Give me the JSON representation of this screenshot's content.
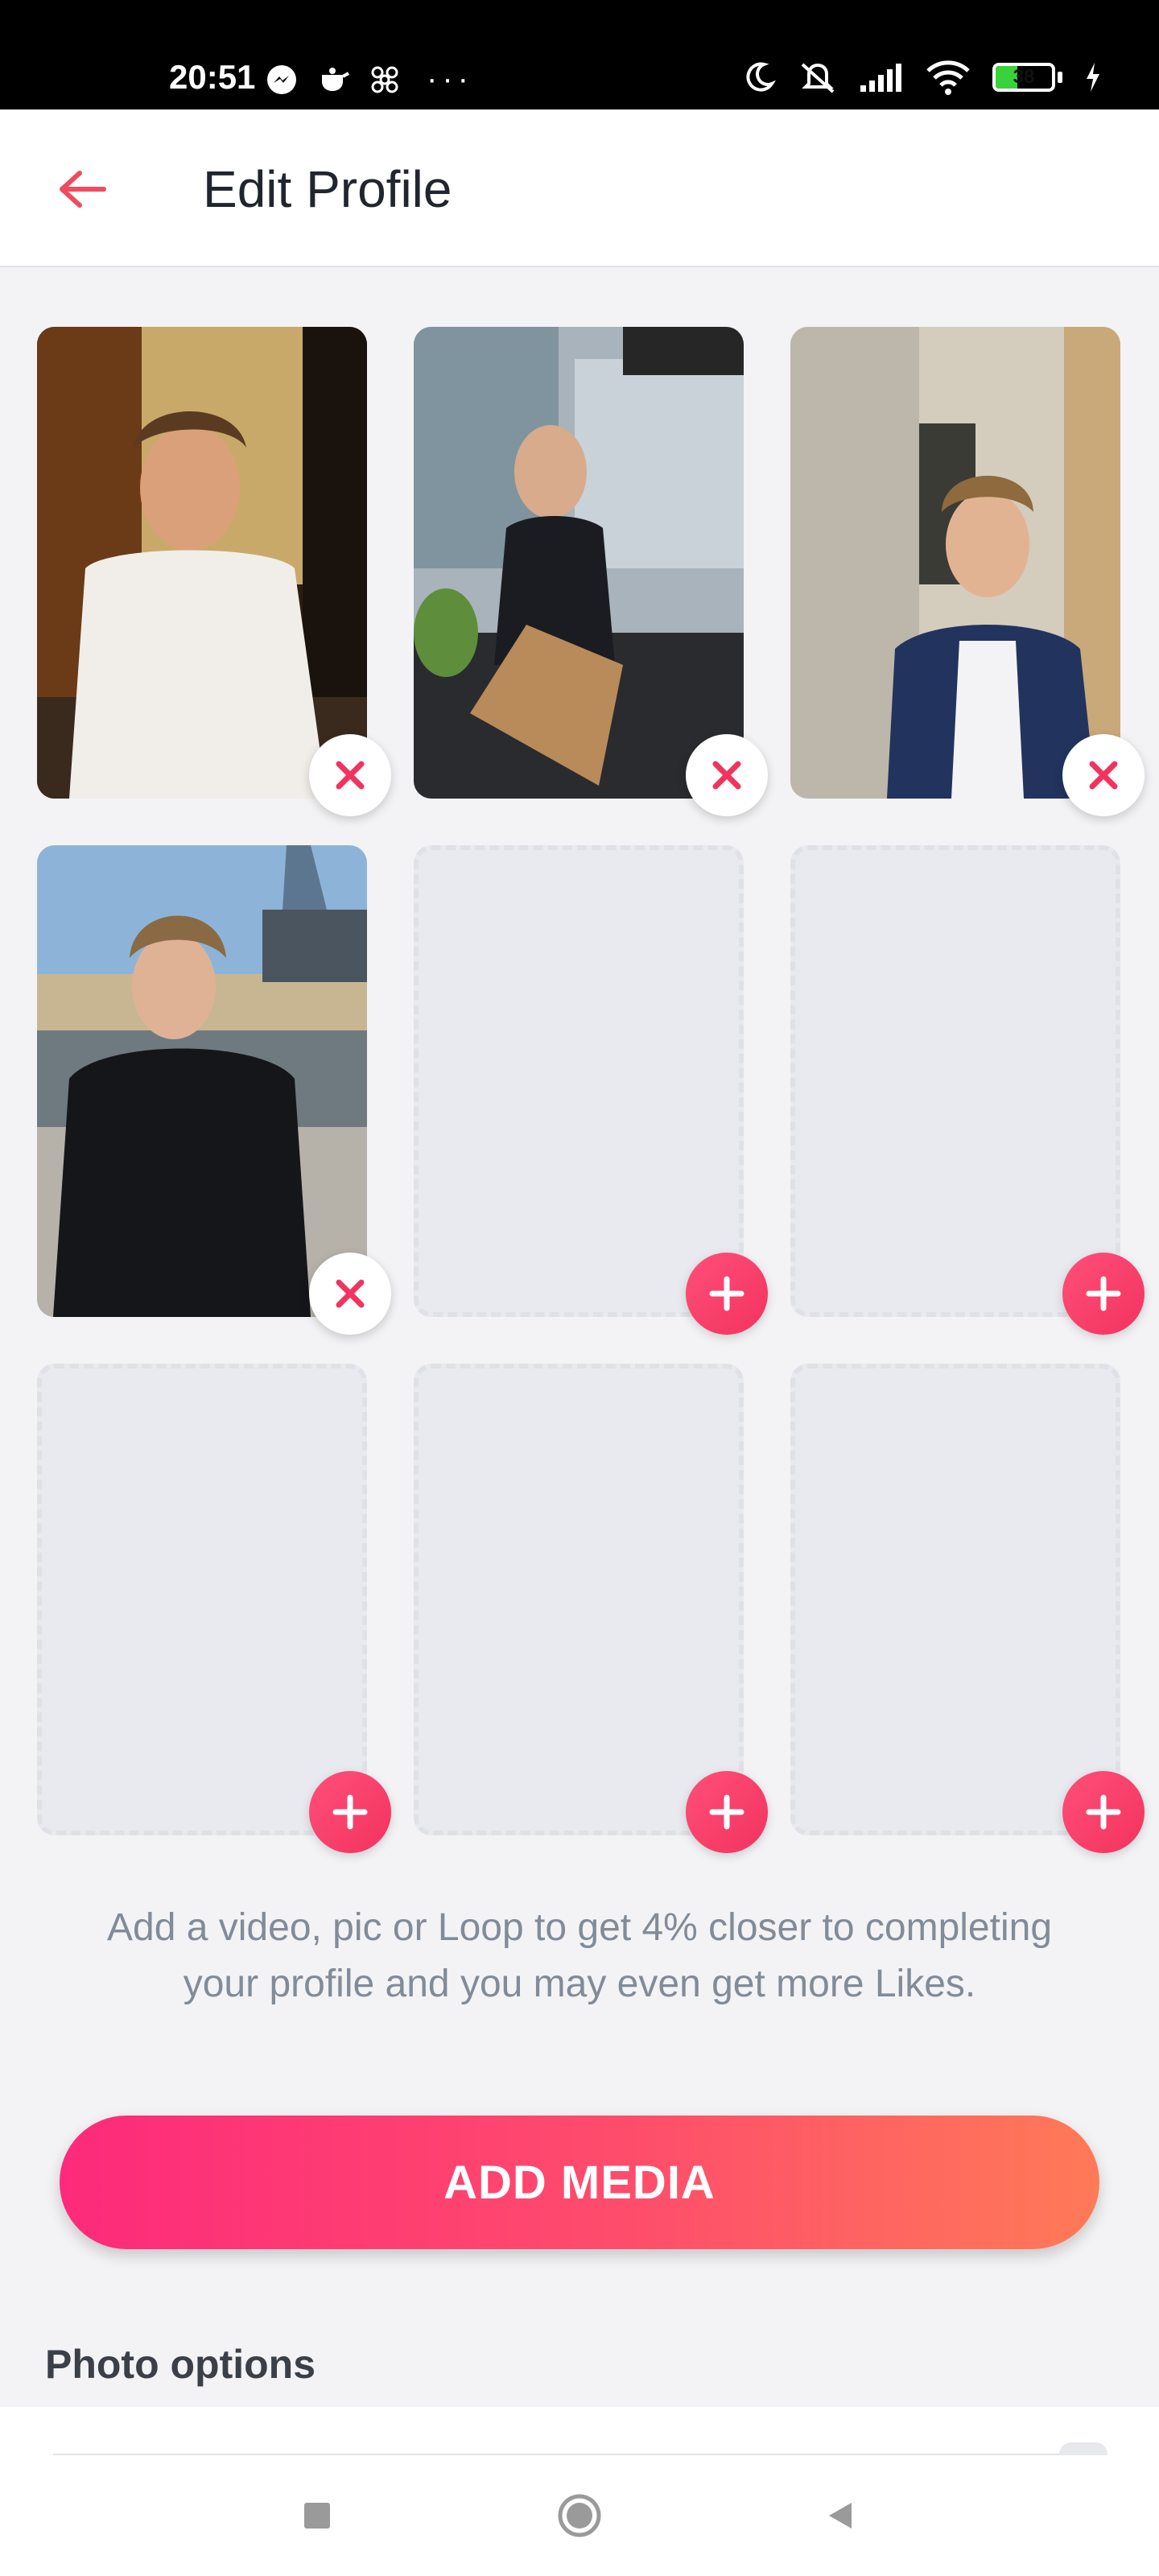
{
  "status_bar": {
    "time": "20:51",
    "left_icons": [
      "messenger-icon",
      "teapot-icon",
      "fan-icon"
    ],
    "dots": "···",
    "battery_level": "38",
    "battery_fraction": 0.38,
    "right_icons": [
      "moon-icon",
      "mute-icon",
      "signal-icon",
      "wifi-icon",
      "battery-icon",
      "charging-icon"
    ]
  },
  "header": {
    "title": "Edit Profile",
    "back_icon": "arrow-left-icon",
    "accent": "#ef4b5f"
  },
  "media_grid": {
    "tiles": [
      {
        "type": "photo",
        "action": "remove",
        "photo_subject": "man in white shirt at cafe"
      },
      {
        "type": "photo",
        "action": "remove",
        "photo_subject": "man at outdoor cafe table"
      },
      {
        "type": "photo",
        "action": "remove",
        "photo_subject": "man in blue blazer on street"
      },
      {
        "type": "photo",
        "action": "remove",
        "photo_subject": "man in black coat by river"
      },
      {
        "type": "empty",
        "action": "add"
      },
      {
        "type": "empty",
        "action": "add"
      },
      {
        "type": "empty",
        "action": "add"
      },
      {
        "type": "empty",
        "action": "add"
      },
      {
        "type": "empty",
        "action": "add"
      }
    ],
    "remove_icon_color": "#f2335e",
    "add_button_color": "#f43d63"
  },
  "hint_text": "Add a video, pic or Loop to get 4% closer to completing your profile and you may even get more Likes.",
  "add_media_label": "ADD MEDIA",
  "photo_options_title": "Photo options",
  "nav": {
    "recent_icon": "square-icon",
    "home_icon": "circle-icon",
    "back_icon": "triangle-back-icon"
  }
}
